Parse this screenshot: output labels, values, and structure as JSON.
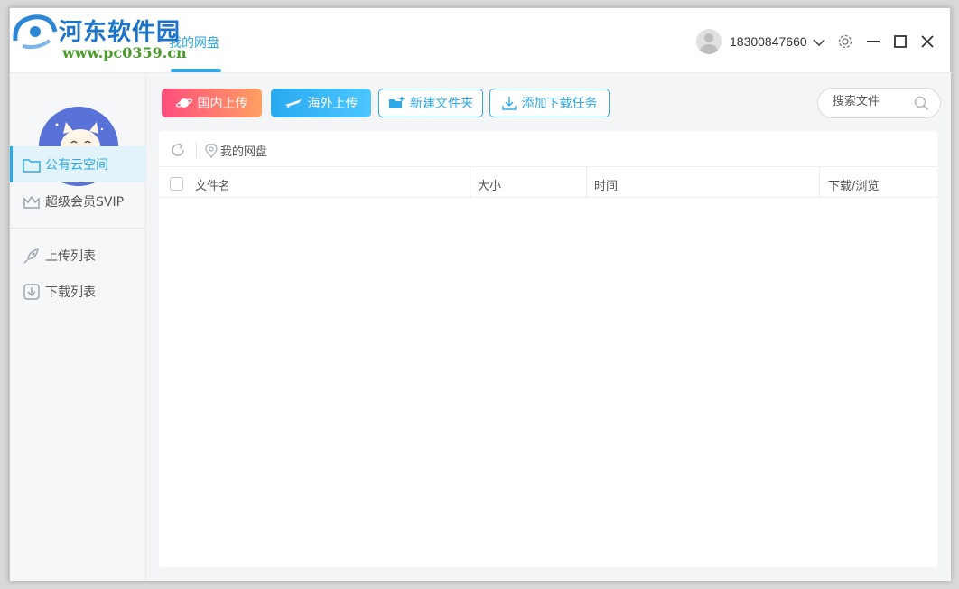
{
  "watermark": {
    "title": "河东软件园",
    "url": "www.pc0359.cn"
  },
  "header": {
    "active_tab": "我的网盘",
    "user": {
      "name": "18300847660"
    },
    "icons": {
      "settings": "gear-icon",
      "minimize": "minimize-icon",
      "maximize": "maximize-icon",
      "close": "close-icon"
    }
  },
  "sidebar": {
    "items": [
      {
        "label": "公有云空间",
        "icon": "folder-icon",
        "active": true
      },
      {
        "label": "超级会员SVIP",
        "icon": "crown-icon",
        "active": false
      },
      {
        "label": "上传列表",
        "icon": "rocket-icon",
        "active": false
      },
      {
        "label": "下载列表",
        "icon": "download-box-icon",
        "active": false
      }
    ]
  },
  "toolbar": {
    "domestic_upload": "国内上传",
    "overseas_upload": "海外上传",
    "new_folder": "新建文件夹",
    "add_download": "添加下载任务",
    "search_placeholder": "搜索文件"
  },
  "breadcrumb": {
    "path": "我的网盘"
  },
  "table": {
    "columns": [
      "文件名",
      "大小",
      "时间",
      "下载/浏览"
    ],
    "rows": []
  },
  "colors": {
    "accent": "#2fa9e6",
    "domestic_gradient": [
      "#ff4d7d",
      "#ffa063"
    ],
    "overseas_gradient": [
      "#29a9f0",
      "#4cc7ff"
    ]
  }
}
